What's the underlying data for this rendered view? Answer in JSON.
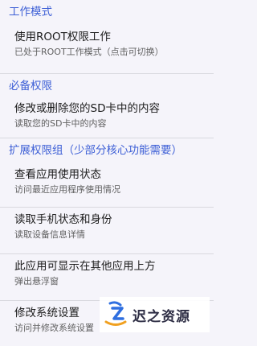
{
  "sections": [
    {
      "header": "工作模式",
      "items": [
        {
          "title": "使用ROOT权限工作",
          "summary": "已处于ROOT工作模式（点击可切换）"
        }
      ]
    },
    {
      "header": "必备权限",
      "items": [
        {
          "title": "修改或删除您的SD卡中的内容",
          "summary": "读取您的SD卡中的内容"
        }
      ]
    },
    {
      "header": "扩展权限组（少部分核心功能需要）",
      "items": [
        {
          "title": "查看应用使用状态",
          "summary": "访问最近应用程序使用情况"
        },
        {
          "title": "读取手机状态和身份",
          "summary": "读取设备信息详情"
        },
        {
          "title": "此应用可显示在其他应用上方",
          "summary": "弹出悬浮窗"
        },
        {
          "title": "修改系统设置",
          "summary": "访问并修改系统设置"
        }
      ]
    }
  ],
  "watermark": {
    "text": "迟之资源",
    "icon": "logo-icon"
  },
  "colors": {
    "accent": "#3d5fd6",
    "background": "#f5f4fa"
  }
}
